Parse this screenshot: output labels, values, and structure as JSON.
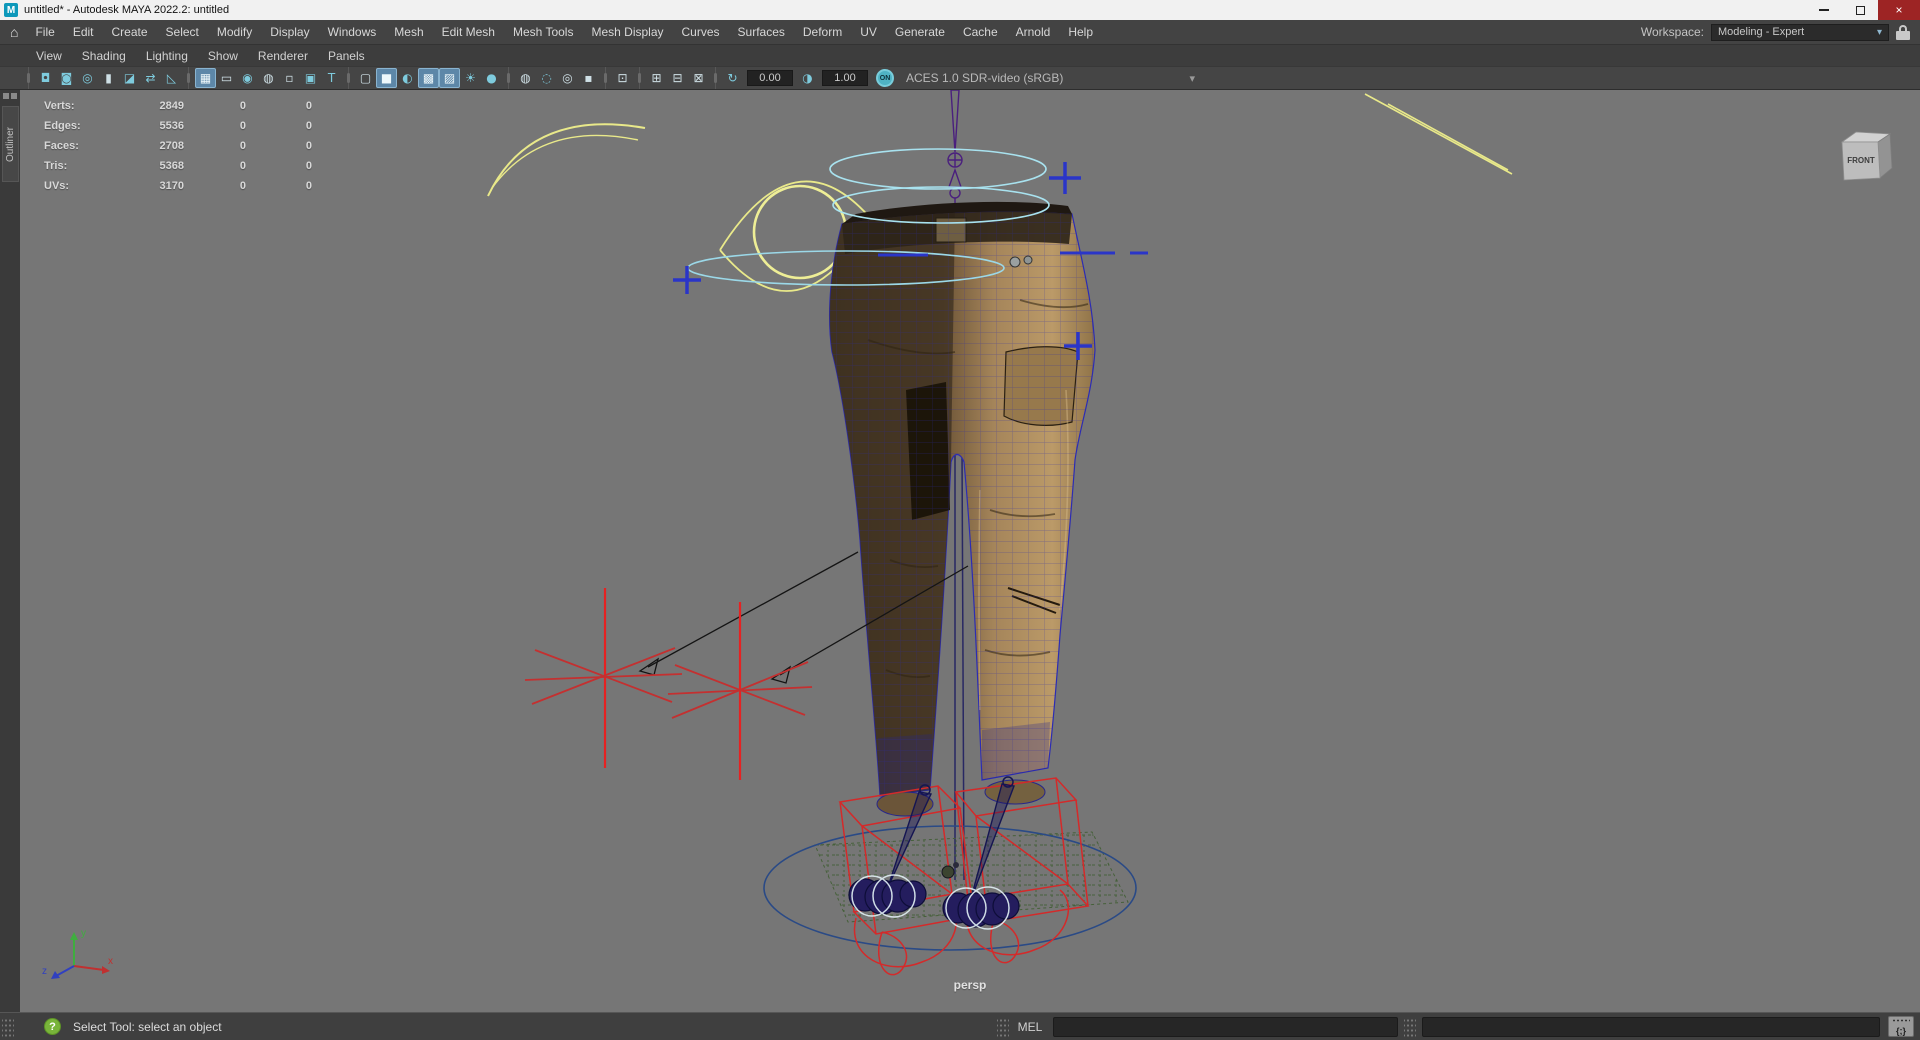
{
  "window": {
    "app_glyph": "M",
    "title": "untitled* - Autodesk MAYA 2022.2: untitled",
    "close_glyph": "×"
  },
  "menubar": {
    "home_glyph": "⌂",
    "items": [
      "File",
      "Edit",
      "Create",
      "Select",
      "Modify",
      "Display",
      "Windows",
      "Mesh",
      "Edit Mesh",
      "Mesh Tools",
      "Mesh Display",
      "Curves",
      "Surfaces",
      "Deform",
      "UV",
      "Generate",
      "Cache",
      "Arnold",
      "Help"
    ],
    "workspace_label": "Workspace:",
    "workspace_value": "Modeling - Expert",
    "dropdown_glyph": "▾"
  },
  "panel": {
    "outliner_tab": "Outliner",
    "menus": [
      "View",
      "Shading",
      "Lighting",
      "Show",
      "Renderer",
      "Panels"
    ]
  },
  "toolbar": {
    "camera_group": [
      "◘",
      "◙",
      "◎",
      "▮",
      "◪",
      "⇄",
      "◺"
    ],
    "gate_group": [
      "▦",
      "▭",
      "◉",
      "◍",
      "▫",
      "▣",
      "T"
    ],
    "shading_group": [
      "▢",
      "■",
      "◐",
      "▩",
      "▨",
      "☀",
      "●"
    ],
    "post_group": [
      "◍",
      "◌",
      "◎",
      "▪"
    ],
    "isolate_glyph": "⊡",
    "pane_group": [
      "⊞",
      "⊟",
      "⊠"
    ],
    "exposure_glyph": "↻",
    "exposure_value": "0.00",
    "gamma_glyph": "◑",
    "gamma_value": "1.00",
    "colormanagement_toggle": "ON",
    "colorspace": "ACES 1.0 SDR-video (sRGB)",
    "dropdown_glyph": "▾"
  },
  "hud": {
    "rows": [
      {
        "label": "Verts:",
        "value": "2849",
        "sel": "0",
        "other": "0"
      },
      {
        "label": "Edges:",
        "value": "5536",
        "sel": "0",
        "other": "0"
      },
      {
        "label": "Faces:",
        "value": "2708",
        "sel": "0",
        "other": "0"
      },
      {
        "label": "Tris:",
        "value": "5368",
        "sel": "0",
        "other": "0"
      },
      {
        "label": "UVs:",
        "value": "3170",
        "sel": "0",
        "other": "0"
      }
    ]
  },
  "viewport": {
    "camera_label": "persp",
    "viewcube_label": "FRONT",
    "axis_x": "x",
    "axis_y": "y",
    "axis_z": "z"
  },
  "statusbar": {
    "help_glyph": "?",
    "help_text": "Select Tool: select an object",
    "mel_label": "MEL",
    "script_editor_glyph": "{;}"
  }
}
